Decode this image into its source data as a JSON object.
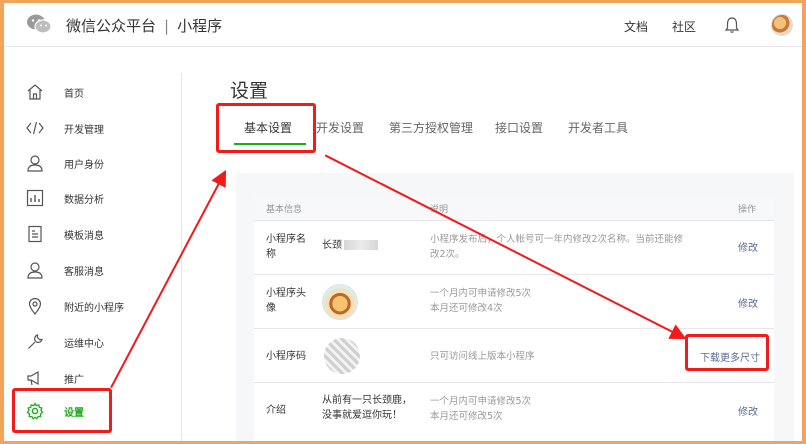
{
  "header": {
    "brand": "微信公众平台",
    "separator": "|",
    "product": "小程序",
    "links": [
      "文档",
      "社区"
    ]
  },
  "sidebar": {
    "items": [
      {
        "label": "首页",
        "icon": "home-icon"
      },
      {
        "label": "开发管理",
        "icon": "code-icon"
      },
      {
        "label": "用户身份",
        "icon": "user-icon"
      },
      {
        "label": "数据分析",
        "icon": "chart-icon"
      },
      {
        "label": "模板消息",
        "icon": "document-icon"
      },
      {
        "label": "客服消息",
        "icon": "customer-service-icon"
      },
      {
        "label": "附近的小程序",
        "icon": "location-icon"
      },
      {
        "label": "运维中心",
        "icon": "wrench-icon"
      },
      {
        "label": "推广",
        "icon": "megaphone-icon"
      },
      {
        "label": "设置",
        "icon": "gear-icon",
        "active": true
      }
    ]
  },
  "main": {
    "title": "设置",
    "tabs": [
      "基本设置",
      "开发设置",
      "第三方授权管理",
      "接口设置",
      "开发者工具"
    ],
    "table": {
      "headers": {
        "info": "基本信息",
        "desc": "说明",
        "op": "操作"
      },
      "rows": [
        {
          "name": "小程序名称",
          "value": "长颈",
          "desc": "小程序发布后，个人帐号可一年内修改2次名称。当前还能修改2次。",
          "op": "修改"
        },
        {
          "name": "小程序头像",
          "desc": "一个月内可申请修改5次\n本月还可修改4次",
          "op": "修改"
        },
        {
          "name": "小程序码",
          "desc": "只可访问线上版本小程序",
          "op": "下载更多尺寸"
        },
        {
          "name": "介绍",
          "value": "从前有一只长颈鹿，没事就爱逗你玩！",
          "desc": "一个月内可申请修改5次\n本月还可修改5次",
          "op": "修改"
        }
      ]
    }
  },
  "colors": {
    "accent": "#1aad19",
    "link": "#576b95",
    "annotation": "#f01c1c",
    "border": "#f4a35a"
  }
}
